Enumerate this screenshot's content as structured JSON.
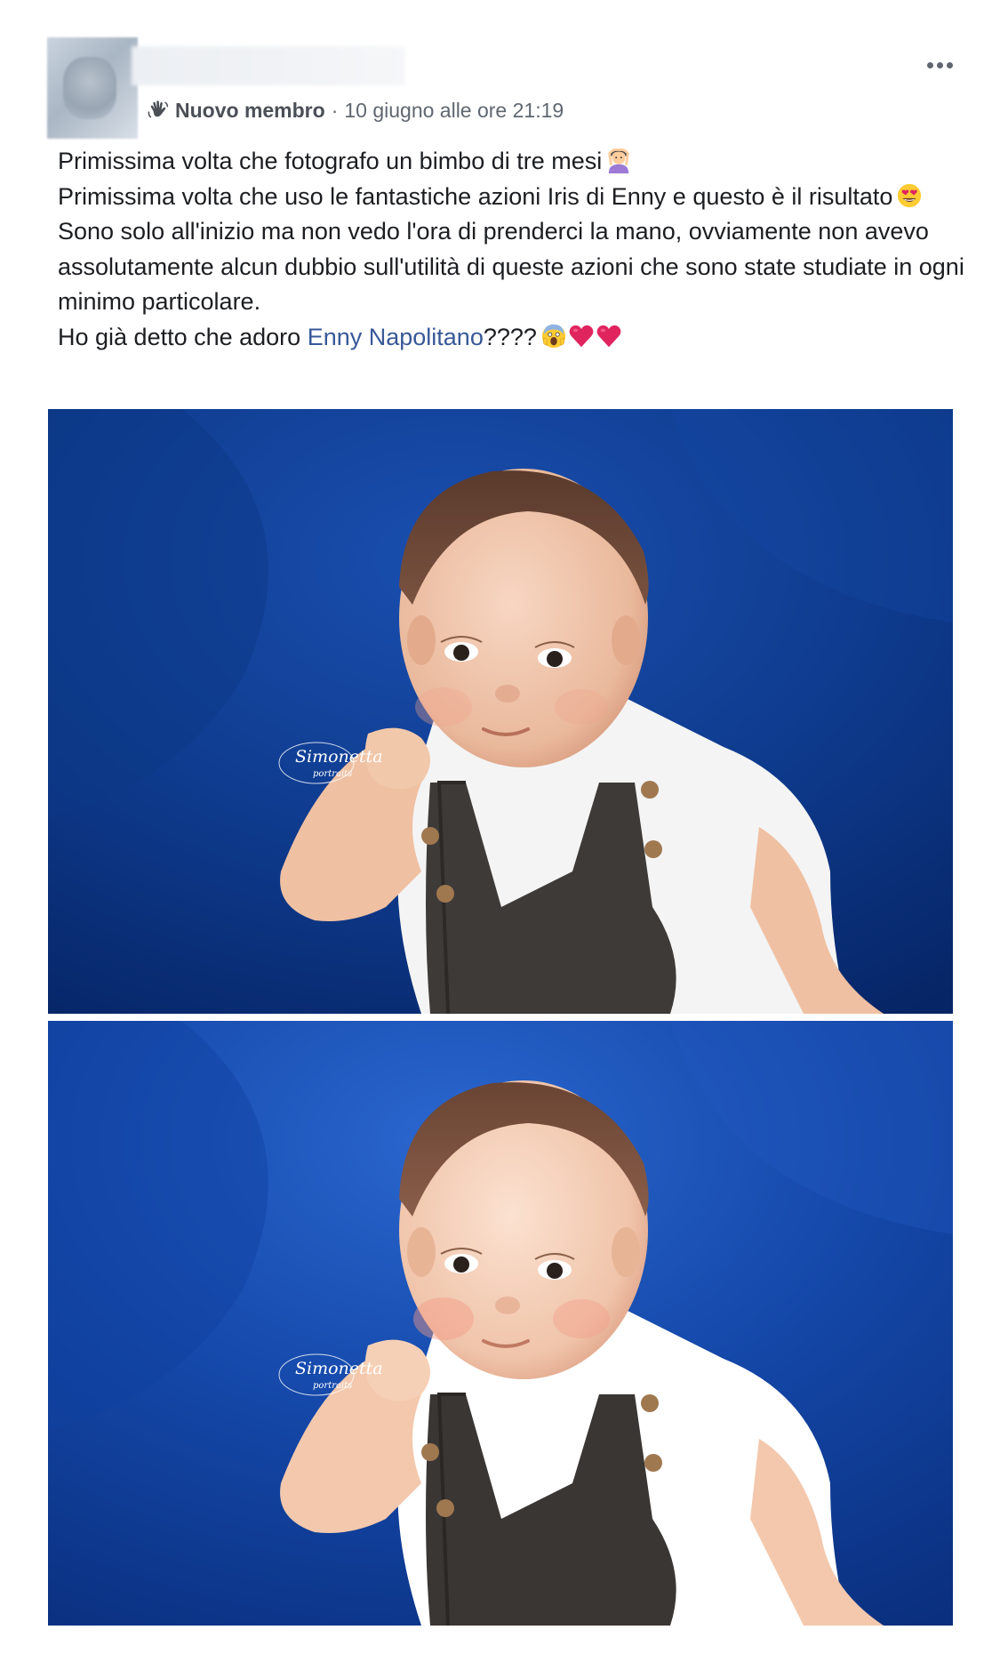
{
  "post": {
    "badge": {
      "icon": "wave-hand-icon",
      "label": "Nuovo membro"
    },
    "separator": "·",
    "timestamp": "10 giugno alle ore 21:19",
    "more_icon": "more-horizontal-icon",
    "text": {
      "line1": "Primissima volta che fotografo un bimbo di tre mesi",
      "line1_emoji": "person-gesturing-ok-emoji",
      "line2": "Primissima volta che uso le fantastiche azioni Iris di Enny e questo è il risultato",
      "line2_emoji": "heart-eyes-emoji",
      "line3": "Sono solo all'inizio ma non vedo l'ora di prenderci la mano, ovviamente non avevo assolutamente alcun dubbio sull'utilità di queste azioni che sono state studiate in ogni minimo particolare.",
      "line4_before": "Ho già detto che adoro ",
      "mention": "Enny Napolitano",
      "line4_after": "????",
      "line4_emojis": [
        "face-screaming-emoji",
        "red-heart-emoji",
        "red-heart-emoji"
      ]
    },
    "photos": [
      {
        "description": "baby-portrait-before",
        "watermark_line1": "Simonetta",
        "watermark_line2": "portraits"
      },
      {
        "description": "baby-portrait-after",
        "watermark_line1": "Simonetta",
        "watermark_line2": "portraits"
      }
    ]
  },
  "colors": {
    "text": "#1c1e21",
    "meta": "#606770",
    "link": "#385898",
    "backdrop": "#0e3a8c",
    "heart": "#e0245e"
  }
}
